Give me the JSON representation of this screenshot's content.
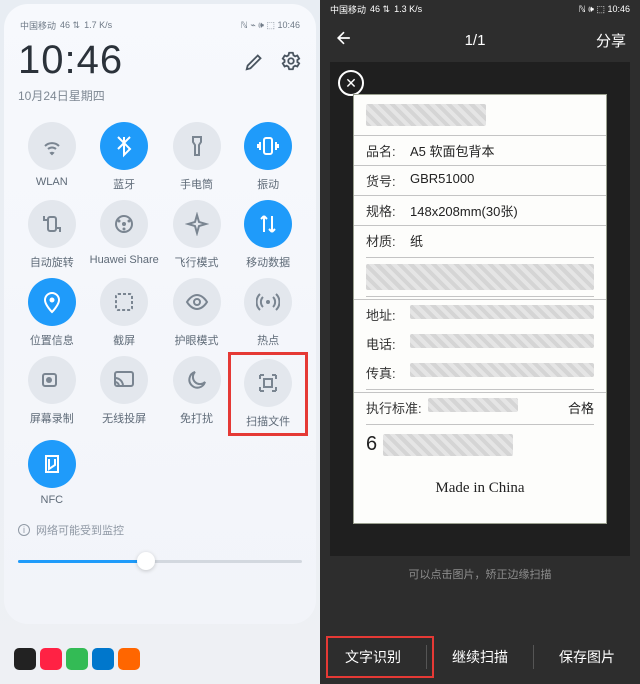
{
  "left": {
    "status": {
      "carrier": "中国移动",
      "net": "46 ⇅",
      "speed": "1.7 K/s",
      "right": "ℕ ⌁ 🕪 ⬚ 10:46"
    },
    "time": "10:46",
    "date": "10月24日星期四",
    "tiles": [
      {
        "name": "wlan",
        "label": "WLAN",
        "active": false,
        "icon": "wifi"
      },
      {
        "name": "bluetooth",
        "label": "蓝牙",
        "active": true,
        "icon": "bluetooth"
      },
      {
        "name": "flashlight",
        "label": "手电筒",
        "active": false,
        "icon": "flashlight"
      },
      {
        "name": "vibrate",
        "label": "振动",
        "active": true,
        "icon": "vibrate"
      },
      {
        "name": "autorotate",
        "label": "自动旋转",
        "active": false,
        "icon": "rotate"
      },
      {
        "name": "huaweishare",
        "label": "Huawei Share",
        "active": false,
        "icon": "share"
      },
      {
        "name": "airplane",
        "label": "飞行模式",
        "active": false,
        "icon": "airplane"
      },
      {
        "name": "mobiledata",
        "label": "移动数据",
        "active": true,
        "icon": "data"
      },
      {
        "name": "location",
        "label": "位置信息",
        "active": true,
        "icon": "location"
      },
      {
        "name": "screenshot",
        "label": "截屏",
        "active": false,
        "icon": "screenshot"
      },
      {
        "name": "eyecare",
        "label": "护眼模式",
        "active": false,
        "icon": "eye"
      },
      {
        "name": "hotspot",
        "label": "热点",
        "active": false,
        "icon": "hotspot"
      },
      {
        "name": "screenrec",
        "label": "屏幕录制",
        "active": false,
        "icon": "record"
      },
      {
        "name": "cast",
        "label": "无线投屏",
        "active": false,
        "icon": "cast"
      },
      {
        "name": "dnd",
        "label": "免打扰",
        "active": false,
        "icon": "moon"
      },
      {
        "name": "scandoc",
        "label": "扫描文件",
        "active": false,
        "icon": "scan",
        "highlight": true
      },
      {
        "name": "nfc",
        "label": "NFC",
        "active": true,
        "icon": "nfc"
      }
    ],
    "warning": "网络可能受到监控",
    "brightness_pct": 45,
    "dock_colors": [
      "#222",
      "#f24",
      "#3b5",
      "#07c",
      "#f60"
    ]
  },
  "right": {
    "status": {
      "carrier": "中国移动",
      "net": "46 ⇅",
      "speed": "1.3 K/s",
      "right": "ℕ 🕪 ⬚ 10:46"
    },
    "counter": "1/1",
    "share": "分享",
    "hint": "可以点击图片，矫正边缘扫描",
    "actions": {
      "ocr": "文字识别",
      "continue": "继续扫描",
      "save": "保存图片"
    },
    "document": {
      "rows": [
        {
          "k": "品名:",
          "v": "A5 软面包背本"
        },
        {
          "k": "货号:",
          "v": "GBR51000"
        },
        {
          "k": "规格:",
          "v": "148x208mm(30张)"
        },
        {
          "k": "材质:",
          "v": "纸"
        }
      ],
      "contact_labels": {
        "addr": "地址:",
        "tel": "电话:",
        "fax": "传真:"
      },
      "std_label": "执行标准:",
      "std_status": "合格",
      "made_in": "Made in China"
    }
  }
}
